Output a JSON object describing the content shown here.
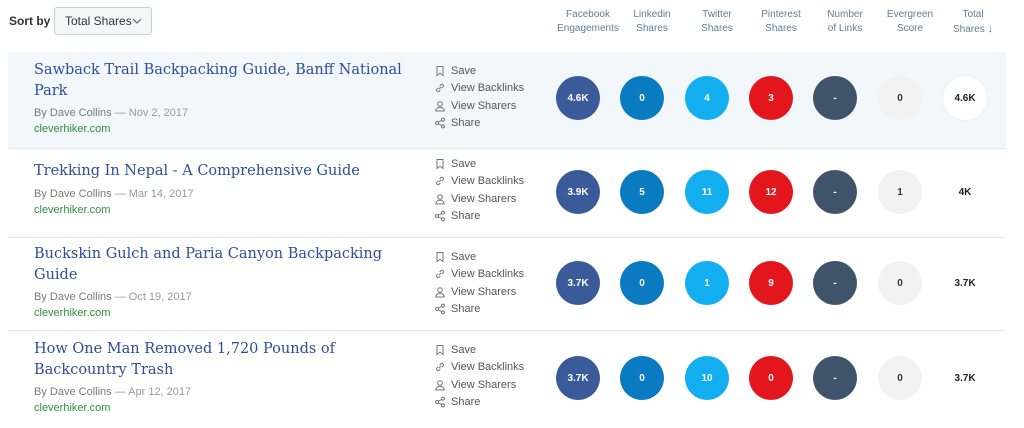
{
  "sort": {
    "label": "Sort by",
    "value": "Total Shares"
  },
  "columns": [
    {
      "line1": "Facebook",
      "line2": "Engagements"
    },
    {
      "line1": "Linkedin",
      "line2": "Shares"
    },
    {
      "line1": "Twitter",
      "line2": "Shares"
    },
    {
      "line1": "Pinterest",
      "line2": "Shares"
    },
    {
      "line1": "Number",
      "line2": "of Links"
    },
    {
      "line1": "Evergreen",
      "line2": "Score"
    },
    {
      "line1": "Total",
      "line2": "Shares",
      "arrow": "↓"
    }
  ],
  "actions": {
    "save": "Save",
    "backlinks": "View Backlinks",
    "sharers": "View Sharers",
    "share": "Share"
  },
  "colors": {
    "facebook": "#3b5a9a",
    "linkedin": "#0a7bc1",
    "twitter": "#12aef0",
    "pinterest": "#e2161c",
    "links": "#3f536a",
    "title": "#2e4d9c",
    "domain": "#2f8f3c"
  },
  "articles": [
    {
      "title": "Sawback Trail Backpacking Guide, Banff National Park",
      "author": "By Dave Collins",
      "date": "— Nov 2, 2017",
      "domain": "cleverhiker.com",
      "facebook": "4.6K",
      "linkedin": "0",
      "twitter": "4",
      "pinterest": "3",
      "links": "-",
      "evergreen": "0",
      "total": "4.6K"
    },
    {
      "title": "Trekking In Nepal - A Comprehensive Guide",
      "author": "By Dave Collins",
      "date": "— Mar 14, 2017",
      "domain": "cleverhiker.com",
      "facebook": "3.9K",
      "linkedin": "5",
      "twitter": "11",
      "pinterest": "12",
      "links": "-",
      "evergreen": "1",
      "total": "4K"
    },
    {
      "title": "Buckskin Gulch and Paria Canyon Backpacking Guide",
      "author": "By Dave Collins",
      "date": "— Oct 19, 2017",
      "domain": "cleverhiker.com",
      "facebook": "3.7K",
      "linkedin": "0",
      "twitter": "1",
      "pinterest": "9",
      "links": "-",
      "evergreen": "0",
      "total": "3.7K"
    },
    {
      "title": "How One Man Removed 1,720 Pounds of Backcountry Trash",
      "author": "By Dave Collins",
      "date": "— Apr 12, 2017",
      "domain": "cleverhiker.com",
      "facebook": "3.7K",
      "linkedin": "0",
      "twitter": "10",
      "pinterest": "0",
      "links": "-",
      "evergreen": "0",
      "total": "3.7K"
    }
  ]
}
